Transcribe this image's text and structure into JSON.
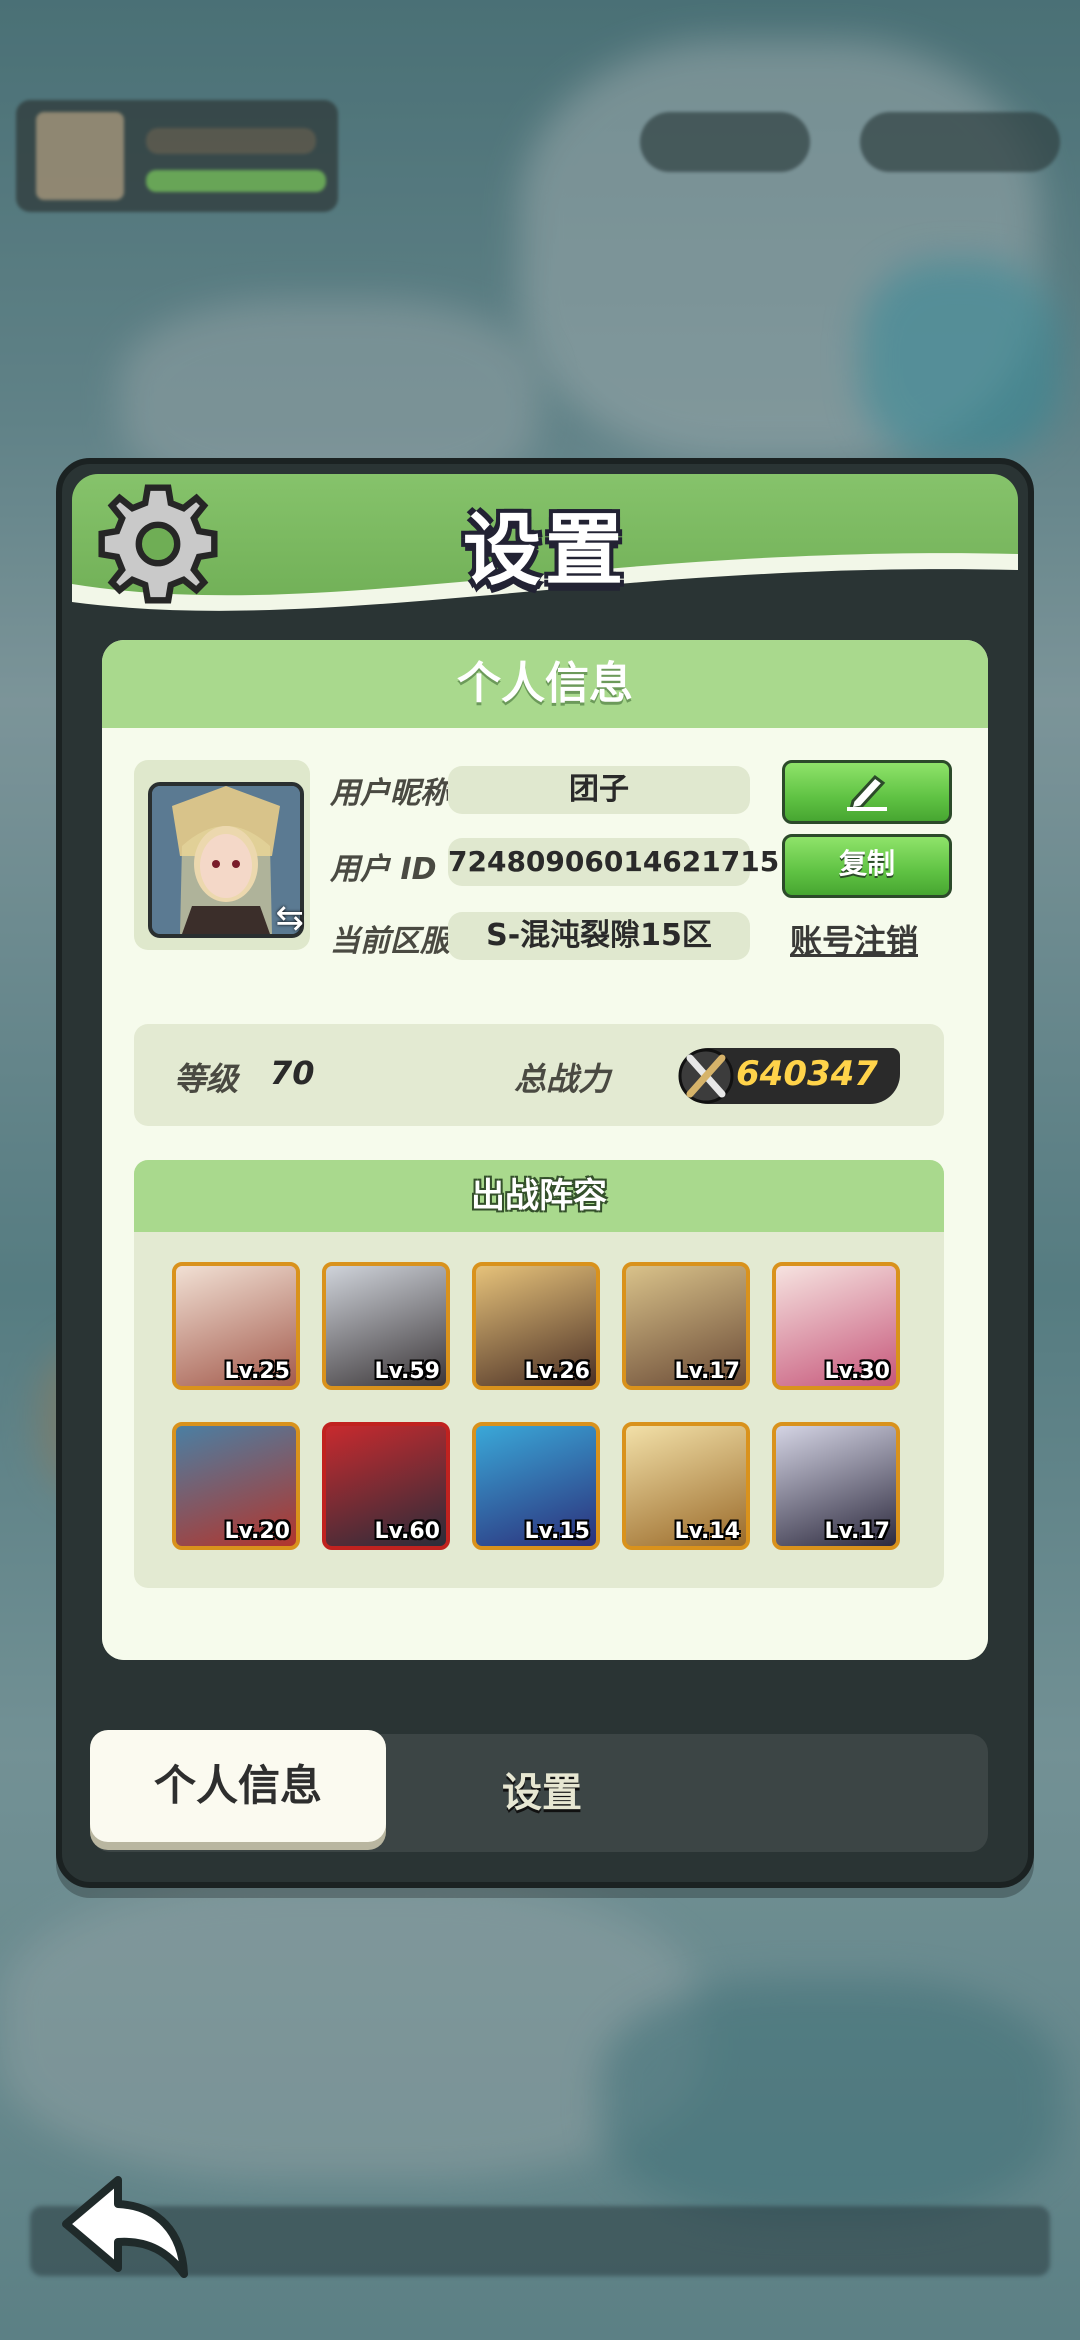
{
  "title": "设置",
  "card_title": "个人信息",
  "profile": {
    "nickname_label": "用户昵称",
    "nickname": "团子",
    "id_label": "用户  ID",
    "user_id": "72480906014621715",
    "server_label": "当前区服",
    "server": "S-混沌裂隙15区",
    "copy_label": "复制",
    "deregister_label": "账号注销"
  },
  "stats": {
    "level_label": "等级",
    "level": "70",
    "power_label": "总战力",
    "power": "640347"
  },
  "lineup": {
    "title": "出战阵容",
    "heroes": [
      {
        "level": "Lv.25"
      },
      {
        "level": "Lv.59"
      },
      {
        "level": "Lv.26"
      },
      {
        "level": "Lv.17"
      },
      {
        "level": "Lv.30"
      },
      {
        "level": "Lv.20"
      },
      {
        "level": "Lv.60"
      },
      {
        "level": "Lv.15"
      },
      {
        "level": "Lv.14"
      },
      {
        "level": "Lv.17"
      }
    ]
  },
  "tabs": {
    "active": "个人信息",
    "inactive": "设置"
  },
  "icons": [
    "gear-icon",
    "edit-icon",
    "swap-avatar-icon",
    "power-swords-icon",
    "back-arrow-icon"
  ],
  "colors": {
    "header_green": "#86c36b",
    "button_green": "#5fc243",
    "hero_border": "#d9921c",
    "power_text": "#ffd34a"
  }
}
